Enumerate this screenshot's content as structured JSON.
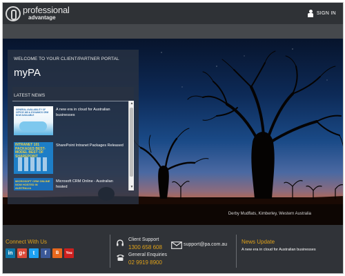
{
  "header": {
    "logo_line1": "professional",
    "logo_line2": "advantage",
    "signin_label": "SIGN IN"
  },
  "hero": {
    "caption": "Derby Mudflats, Kimberley, Western Australia"
  },
  "portal": {
    "welcome": "WELCOME TO YOUR CLIENT/PARTNER PORTAL",
    "title": "myPA",
    "news_heading": "LATEST NEWS",
    "items": [
      {
        "title": "A new era in cloud for Australian businesses",
        "thumb_caption": "GENERAL AVAILABILITY OF OFFICE 365 & DYNAMICS CRM NOW AVAILABLE"
      },
      {
        "title": "SharePoint Intranet Packages Released",
        "thumb_caption": "INTRANET 101 PACKAGES BEST-MODEL BEST OF SHAREPOINT"
      },
      {
        "title": "Microsoft CRM Online - Australian hosted",
        "thumb_caption": "MICROSOFT CRM ONLINE NOW HOSTED IN AUSTRALIA"
      }
    ]
  },
  "footer": {
    "connect_title": "Connect With Us",
    "social": [
      {
        "name": "linkedin",
        "glyph": "in",
        "color": "#0e76a8"
      },
      {
        "name": "googleplus",
        "glyph": "g+",
        "color": "#dd4b39"
      },
      {
        "name": "twitter",
        "glyph": "t",
        "color": "#1da1f2"
      },
      {
        "name": "facebook",
        "glyph": "f",
        "color": "#3b5998"
      },
      {
        "name": "blog",
        "glyph": "B",
        "color": "#e8681d"
      },
      {
        "name": "youtube",
        "glyph": "You",
        "color": "#cd201f"
      }
    ],
    "client_support_label": "Client Support",
    "client_support_number": "1300 658 608",
    "general_enquiries_label": "General Enquiries",
    "general_enquiries_number": "02 9919 8900",
    "email": "support@pa.com.au",
    "news_update_title": "News Update",
    "news_update_text": "A new era in cloud for Australian businesses"
  },
  "colors": {
    "accent": "#e0a21a",
    "header_bg": "#2f3236",
    "footer_bg": "#303338"
  }
}
